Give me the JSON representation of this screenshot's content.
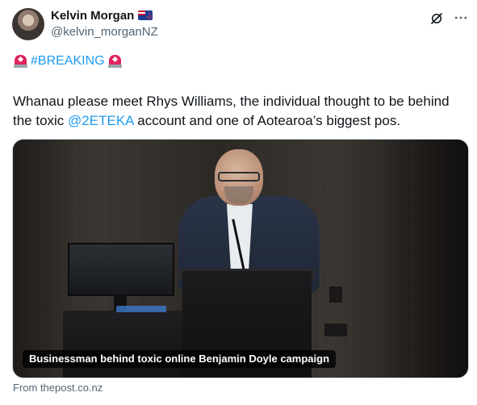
{
  "author": {
    "name": "Kelvin Morgan",
    "handle": "@kelvin_morganNZ",
    "flag_icon": "nz-flag-icon"
  },
  "header_actions": {
    "grok_icon": "grok-icon",
    "more_icon": "more-icon"
  },
  "tweet": {
    "breaking_icon": "police-car-light-icon",
    "hashtag": "#BREAKING",
    "text_part1": "Whanau please meet Rhys Williams, the individual thought to be behind the toxic ",
    "mention": "@2ETEKA",
    "text_part2": " account and one of Aotearoa’s biggest pos."
  },
  "media": {
    "caption": "Businessman behind toxic online Benjamin Doyle campaign",
    "source": "From thepost.co.nz"
  },
  "colors": {
    "link": "#1d9bf0",
    "text": "#0f1419",
    "secondary": "#536471",
    "siren": "#e0245e"
  }
}
